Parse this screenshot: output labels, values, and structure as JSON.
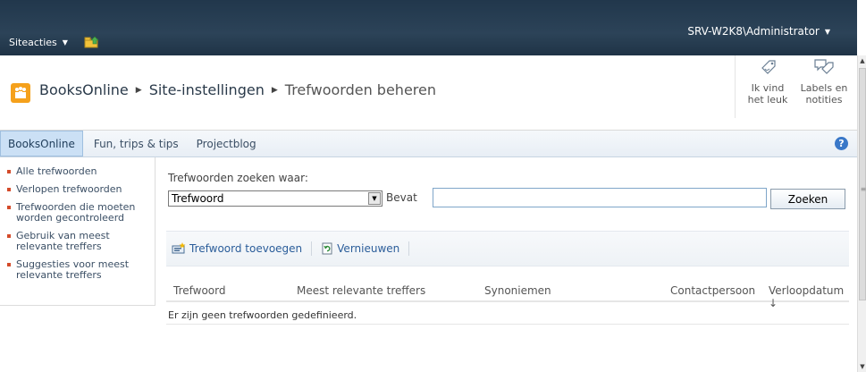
{
  "ribbon": {
    "site_actions_label": "Siteacties",
    "user_label": "SRV-W2K8\\Administrator"
  },
  "title": {
    "breadcrumb": [
      "BooksOnline",
      "Site-instellingen",
      "Trefwoorden beheren"
    ]
  },
  "social": {
    "like_label_line1": "Ik vind",
    "like_label_line2": "het leuk",
    "tags_label_line1": "Labels en",
    "tags_label_line2": "notities"
  },
  "topnav": {
    "tabs": [
      "BooksOnline",
      "Fun, trips & tips",
      "Projectblog"
    ],
    "help": "?"
  },
  "leftnav": {
    "items": [
      "Alle trefwoorden",
      "Verlopen trefwoorden",
      "Trefwoorden die moeten worden gecontroleerd",
      "Gebruik van meest relevante treffers",
      "Suggesties voor meest relevante treffers"
    ]
  },
  "search": {
    "label": "Trefwoorden zoeken waar:",
    "field_selected": "Trefwoord",
    "operator": "Bevat",
    "value": "",
    "button": "Zoeken"
  },
  "toolbar": {
    "add_label": "Trefwoord toevoegen",
    "refresh_label": "Vernieuwen"
  },
  "grid": {
    "columns": [
      "Trefwoord",
      "Meest relevante treffers",
      "Synoniemen",
      "Contactpersoon",
      "Verloopdatum ↓"
    ],
    "empty_message": "Er zijn geen trefwoorden gedefinieerd."
  },
  "colors": {
    "ribbon": "#2c4358",
    "accent": "#f5a11c",
    "link": "#2b5d9a"
  }
}
